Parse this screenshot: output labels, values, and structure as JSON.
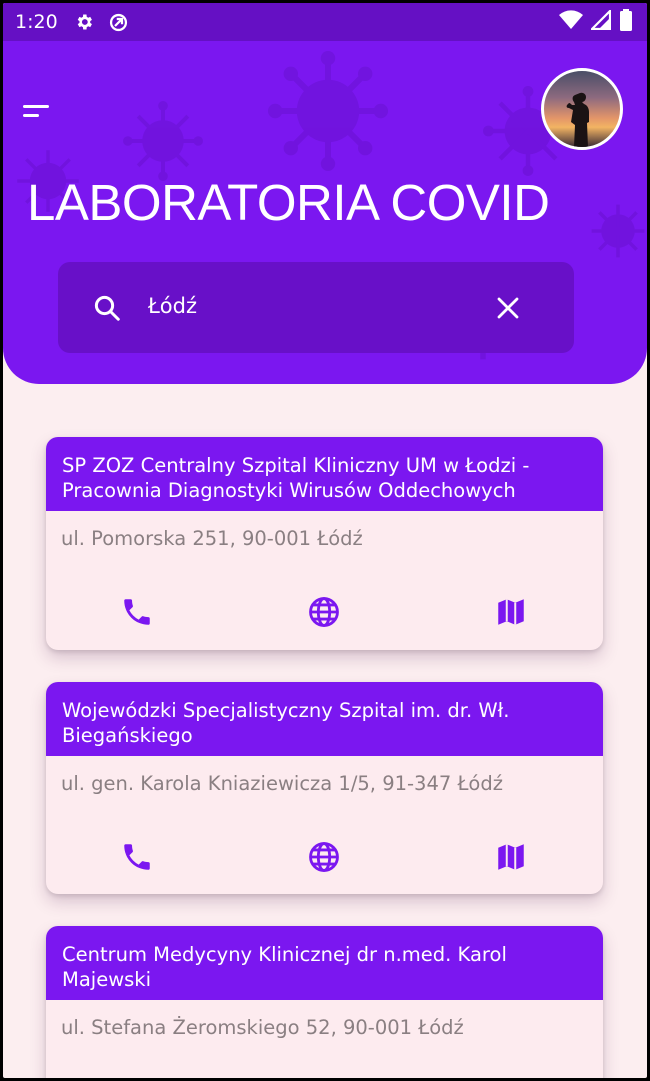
{
  "status_bar": {
    "time": "1:20"
  },
  "header": {
    "title": "LABORATORIA COVID"
  },
  "search": {
    "value": "Łódź"
  },
  "labs": [
    {
      "name": "SP ZOZ Centralny Szpital Kliniczny UM w Łodzi - Pracownia Diagnostyki Wirusów Oddechowych",
      "address": "ul. Pomorska 251, 90-001 Łódź"
    },
    {
      "name": "Wojewódzki Specjalistyczny Szpital im. dr. Wł. Biegańskiego",
      "address": "ul. gen. Karola Kniaziewicza 1/5, 91-347 Łódź"
    },
    {
      "name": "Centrum Medycyny Klinicznej dr n.med. Karol Majewski",
      "address": "ul. Stefana Żeromskiego 52, 90-001 Łódź"
    }
  ],
  "icons": {
    "status": [
      "gear-icon",
      "data-saver-icon",
      "wifi-icon",
      "signal-icon",
      "battery-icon"
    ],
    "card_actions": [
      "phone-icon",
      "globe-icon",
      "map-icon"
    ]
  },
  "colors": {
    "primary": "#7b17f0",
    "status_bar": "#6510c4",
    "search_bg": "#6810c8",
    "background": "#fceef0"
  }
}
